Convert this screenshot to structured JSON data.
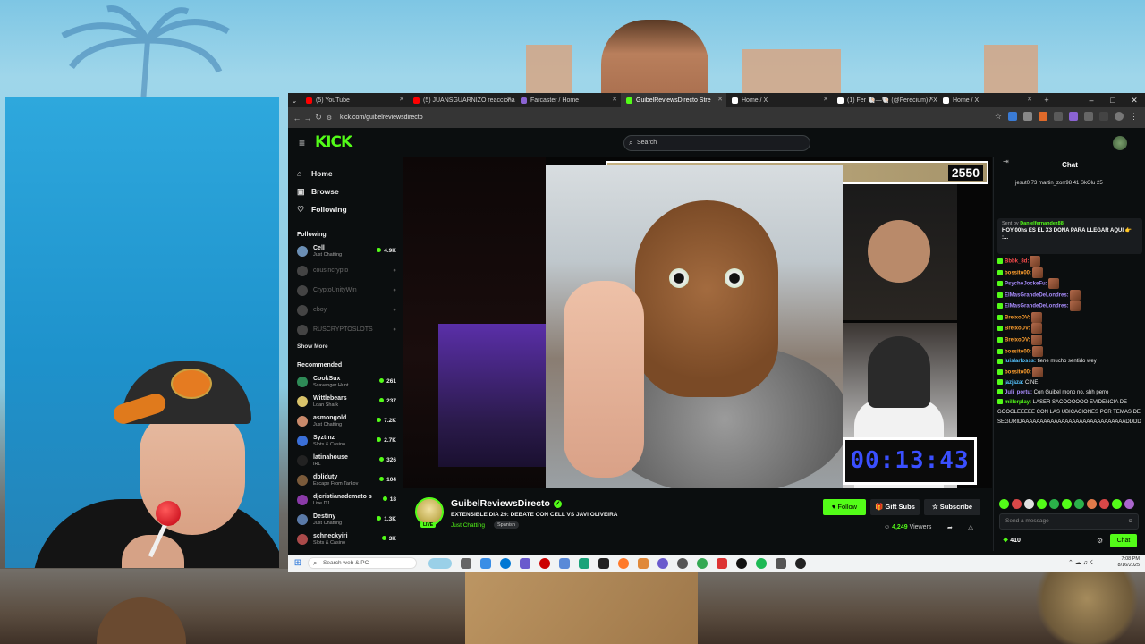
{
  "browser": {
    "tabs": [
      {
        "label": "(5) YouTube",
        "color": "#ff0000"
      },
      {
        "label": "(5) JUANSGUARNIZO reacciona",
        "color": "#ff0000"
      },
      {
        "label": "Farcaster / Home",
        "color": "#8a63d2"
      },
      {
        "label": "GuibelReviewsDirecto Stre",
        "color": "#53fc18",
        "active": true
      },
      {
        "label": "Home / X",
        "color": "#ffffff"
      },
      {
        "label": "(1) Fer 🐚—🐚 (@Ferecium) / X",
        "color": "#ffffff"
      },
      {
        "label": "Home / X",
        "color": "#ffffff"
      }
    ],
    "new_tab": "+",
    "url": "kick.com/guibelreviewsdirecto",
    "win_min": "–",
    "win_max": "□",
    "win_close": "✕"
  },
  "site": {
    "logo": "KICK",
    "search_placeholder": "Search",
    "nav": [
      {
        "label": "Home",
        "icon": "⌂"
      },
      {
        "label": "Browse",
        "icon": "▣"
      },
      {
        "label": "Following",
        "icon": "♡"
      }
    ],
    "following_title": "Following",
    "following": [
      {
        "name": "Cell",
        "sub": "Just Chatting",
        "count": "4.9K",
        "live": true,
        "color": "#6b8fb5"
      },
      {
        "name": "cousincrypto",
        "sub": "",
        "count": "",
        "live": false,
        "color": "#444"
      },
      {
        "name": "CryptoUnityWin",
        "sub": "",
        "count": "",
        "live": false,
        "color": "#444"
      },
      {
        "name": "eboy",
        "sub": "",
        "count": "",
        "live": false,
        "color": "#444"
      },
      {
        "name": "RUSCRYPTOSLOTS",
        "sub": "",
        "count": "",
        "live": false,
        "color": "#444"
      }
    ],
    "show_more": "Show More",
    "recommended_title": "Recommended",
    "recommended": [
      {
        "name": "CookSux",
        "sub": "Scavenger Hunt",
        "count": "261",
        "color": "#2e8b57"
      },
      {
        "name": "Wittlebears",
        "sub": "Loan Shark",
        "count": "237",
        "color": "#d9c36a"
      },
      {
        "name": "asmongold",
        "sub": "Just Chatting",
        "count": "7.2K",
        "color": "#c98a6b"
      },
      {
        "name": "Syztmz",
        "sub": "Slots & Casino",
        "count": "2.7K",
        "color": "#3a6fd8"
      },
      {
        "name": "latinahouse",
        "sub": "IRL",
        "count": "326",
        "color": "#222"
      },
      {
        "name": "dbliduty",
        "sub": "Escape From Tarkov",
        "count": "104",
        "color": "#7a5a3a"
      },
      {
        "name": "djcristianademato s",
        "sub": "Live DJ",
        "count": "18",
        "color": "#8a3aa8"
      },
      {
        "name": "Destiny",
        "sub": "Just Chatting",
        "count": "1.3K",
        "color": "#5a7aa8"
      },
      {
        "name": "schneckyiri",
        "sub": "Slots & Casino",
        "count": "3K",
        "color": "#aa4a4a"
      }
    ]
  },
  "stream": {
    "counter": "2550",
    "timer": "00:13:43",
    "channel": "GuibelReviewsDirecto",
    "live": "LIVE",
    "title": "EXTENSIBLE DIA 29: DEBATE CON CELL VS JAVI OLIVEIRA",
    "category": "Just Chatting",
    "language": "Spanish",
    "follow": "♥ Follow",
    "gift": "🎁 Gift Subs",
    "subscribe": "☆ Subscribe",
    "viewers_count": "4,249",
    "viewers_label": " Viewers"
  },
  "chat": {
    "title": "Chat",
    "top_gifters": "jesut0 73  martin_zorr98 41  SkOlu 25",
    "pinned_by_label": "Sent by",
    "pinned_by": "Danielfernandez88",
    "pinned_msg": "HOY 00hs ES EL X3 DONA PARA LLEGAR AQUI 👉 :...",
    "messages": [
      {
        "user": "Bbbk_8d:",
        "text": "",
        "color": "#ff4d4d",
        "emotes": 1
      },
      {
        "user": "bossito00:",
        "text": "",
        "color": "#ff9f2e",
        "emotes": 1
      },
      {
        "user": "PsychoJockeFu:",
        "text": "",
        "color": "#a78bfa",
        "emotes": 1
      },
      {
        "user": "ElMasGrandeDeLondres:",
        "text": "",
        "color": "#a78bfa",
        "emotes": 1
      },
      {
        "user": "ElMasGrandeDeLondres:",
        "text": "",
        "color": "#a78bfa",
        "emotes": 1
      },
      {
        "user": "BreixoDV:",
        "text": "",
        "color": "#ff9f2e",
        "emotes": 1
      },
      {
        "user": "BreixoDV:",
        "text": "",
        "color": "#ff9f2e",
        "emotes": 1
      },
      {
        "user": "BreixoDV:",
        "text": "",
        "color": "#ff9f2e",
        "emotes": 1
      },
      {
        "user": "bossito00:",
        "text": "",
        "color": "#ff9f2e",
        "emotes": 1
      },
      {
        "user": "luislarlosss:",
        "text": " tiene mucho sentido wey",
        "color": "#56c4ff",
        "emotes": 0
      },
      {
        "user": "bossito00:",
        "text": "",
        "color": "#ff9f2e",
        "emotes": 1
      },
      {
        "user": "jazjaza:",
        "text": " CINE",
        "color": "#56c4ff",
        "emotes": 0
      },
      {
        "user": "Juli_portu:",
        "text": " Con Guibel mono no, shh perro",
        "color": "#a78bfa",
        "emotes": 0
      },
      {
        "user": "millerplay:",
        "text": " LASER SACOOOOOO EVIDENCIA DE GOOGLEEEEE CON LAS UBICACIONES POR TEMAS DE SEGURIDAAAAAAAAAAAAAAAAAAAAAAAAAAAAADDDD",
        "color": "#53fc18",
        "emotes": 0
      }
    ],
    "input_placeholder": "Send a message",
    "points": "410",
    "send": "Chat"
  },
  "taskbar": {
    "search": "Search web & PC",
    "time": "7:08 PM",
    "date": "8/16/2025"
  },
  "colors": {
    "accent": "#53fc18",
    "bg": "#0b0e0f"
  }
}
